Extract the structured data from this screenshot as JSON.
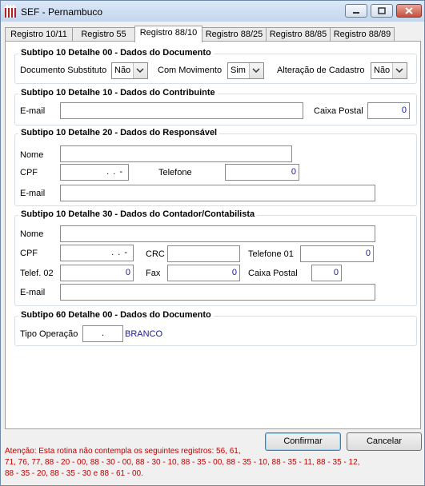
{
  "window": {
    "title": "SEF - Pernambuco"
  },
  "tabs": [
    {
      "label": "Registro 10/11"
    },
    {
      "label": "Registro 55"
    },
    {
      "label": "Registro 88/10"
    },
    {
      "label": "Registro 88/25"
    },
    {
      "label": "Registro 88/85"
    },
    {
      "label": "Registro 88/89"
    }
  ],
  "active_tab": "Registro 88/10",
  "groups": {
    "documento": {
      "title": "Subtipo 10 Detalhe 00 - Dados do Documento",
      "doc_substituto_label": "Documento Substituto",
      "doc_substituto_value": "Não",
      "com_movimento_label": "Com Movimento",
      "com_movimento_value": "Sim",
      "alteracao_label": "Alteração de Cadastro",
      "alteracao_value": "Não"
    },
    "contribuinte": {
      "title": "Subtipo 10 Detalhe 10 - Dados do Contribuinte",
      "email_label": "E-mail",
      "email_value": "",
      "caixa_postal_label": "Caixa Postal",
      "caixa_postal_value": "0"
    },
    "responsavel": {
      "title": "Subtipo 10 Detalhe 20 - Dados do Responsável",
      "nome_label": "Nome",
      "nome_value": "",
      "cpf_label": "CPF",
      "cpf_value": ". . -",
      "telefone_label": "Telefone",
      "telefone_value": "0",
      "email_label": "E-mail",
      "email_value": ""
    },
    "contador": {
      "title": "Subtipo 10 Detalhe 30 - Dados do Contador/Contabilista",
      "nome_label": "Nome",
      "nome_value": "",
      "cpf_label": "CPF",
      "cpf_value": ". . -",
      "crc_label": "CRC",
      "crc_value": "",
      "telefone01_label": "Telefone 01",
      "telefone01_value": "0",
      "telef02_label": "Telef. 02",
      "telef02_value": "0",
      "fax_label": "Fax",
      "fax_value": "0",
      "caixa_postal_label": "Caixa Postal",
      "caixa_postal_value": "0",
      "email_label": "E-mail",
      "email_value": ""
    },
    "documento60": {
      "title": "Subtipo 60 Detalhe 00 - Dados do Documento",
      "tipo_operacao_label": "Tipo Operação",
      "tipo_operacao_value": ".",
      "tipo_operacao_desc": "BRANCO"
    }
  },
  "buttons": {
    "confirmar": "Confirmar",
    "cancelar": "Cancelar"
  },
  "warning": {
    "line1": "Atenção: Esta rotina não contempla os seguintes registros: 56, 61,",
    "line2": "71, 76, 77, 88 - 20 - 00, 88 - 30 - 00, 88 - 30 - 10, 88 - 35 - 00, 88 - 35 - 10, 88 - 35 - 11, 88 - 35 - 12,",
    "line3": "88 - 35 - 20, 88 - 35 - 30 e 88 - 61 - 00."
  },
  "colors": {
    "titlebar": "#c4d6ee",
    "warning_text": "#c00000",
    "numeric_text": "#1a1a9a"
  }
}
